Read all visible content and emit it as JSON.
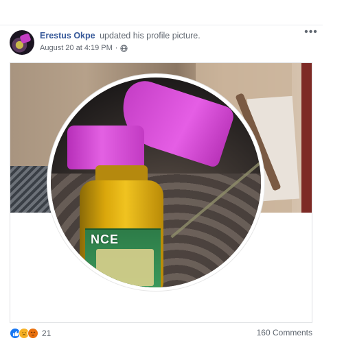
{
  "post": {
    "author_name": "Erestus Okpe",
    "action_text": "updated his profile picture.",
    "timestamp": "August 20 at 4:19 PM",
    "separator": "·",
    "privacy_icon": "globe-icon",
    "more_icon": "more-horizontal-icon",
    "more_glyph": "•••"
  },
  "photo": {
    "bottle_label_text": "NCE"
  },
  "engagement": {
    "reactions": [
      {
        "name": "like",
        "icon": "like-icon",
        "color": "#1877f2"
      },
      {
        "name": "sad",
        "icon": "sad-icon",
        "color": "#f7b125"
      },
      {
        "name": "angry",
        "icon": "angry-icon",
        "color": "#e9710f"
      }
    ],
    "reaction_count": "21",
    "comments_text": "160 Comments"
  },
  "colors": {
    "author_link": "#365899",
    "meta_text": "#616770"
  }
}
